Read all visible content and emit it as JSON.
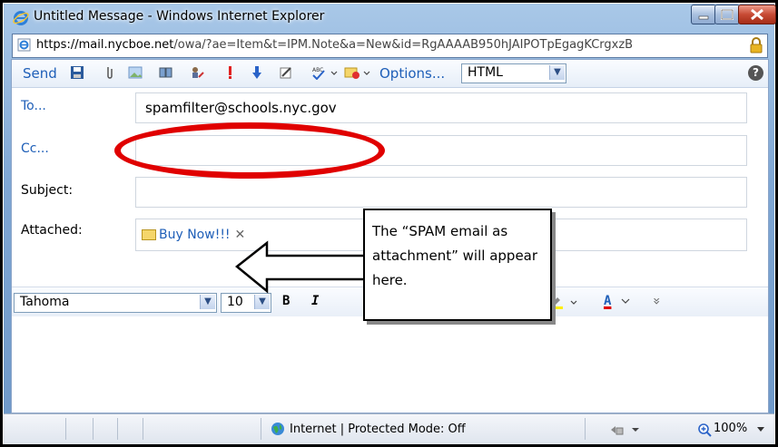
{
  "window": {
    "title": "Untitled Message - Windows Internet Explorer",
    "url_prefix": "https://mail.",
    "url_domain": "nycboe.net",
    "url_rest": "/owa/?ae=Item&t=IPM.Note&a=New&id=RgAAAAB950hJAIPOTpEgagKCrgxzB"
  },
  "toolbar": {
    "send_label": "Send",
    "options_label": "Options...",
    "format_value": "HTML",
    "help_label": "?"
  },
  "form": {
    "to_label": "To...",
    "to_value": "spamfilter@schools.nyc.gov",
    "cc_label": "Cc...",
    "cc_value": "",
    "subject_label": "Subject:",
    "subject_value": "",
    "attached_label": "Attached:",
    "attachment_name": "Buy Now!!!",
    "attachment_remove": "✕"
  },
  "format_bar": {
    "font_value": "Tahoma",
    "size_value": "10",
    "bold_label": "B",
    "italic_label": "I",
    "font_color_label": "A",
    "more_label": "»"
  },
  "annotation": {
    "callout_text": "The “SPAM email as attachment” will appear here."
  },
  "statusbar": {
    "zone_text": "Internet | Protected Mode: Off",
    "zoom_text": "100%"
  },
  "colors": {
    "link_blue": "#1f5fb8",
    "highlight_red": "#e00000",
    "chrome_blue": "#7fa7d4"
  }
}
